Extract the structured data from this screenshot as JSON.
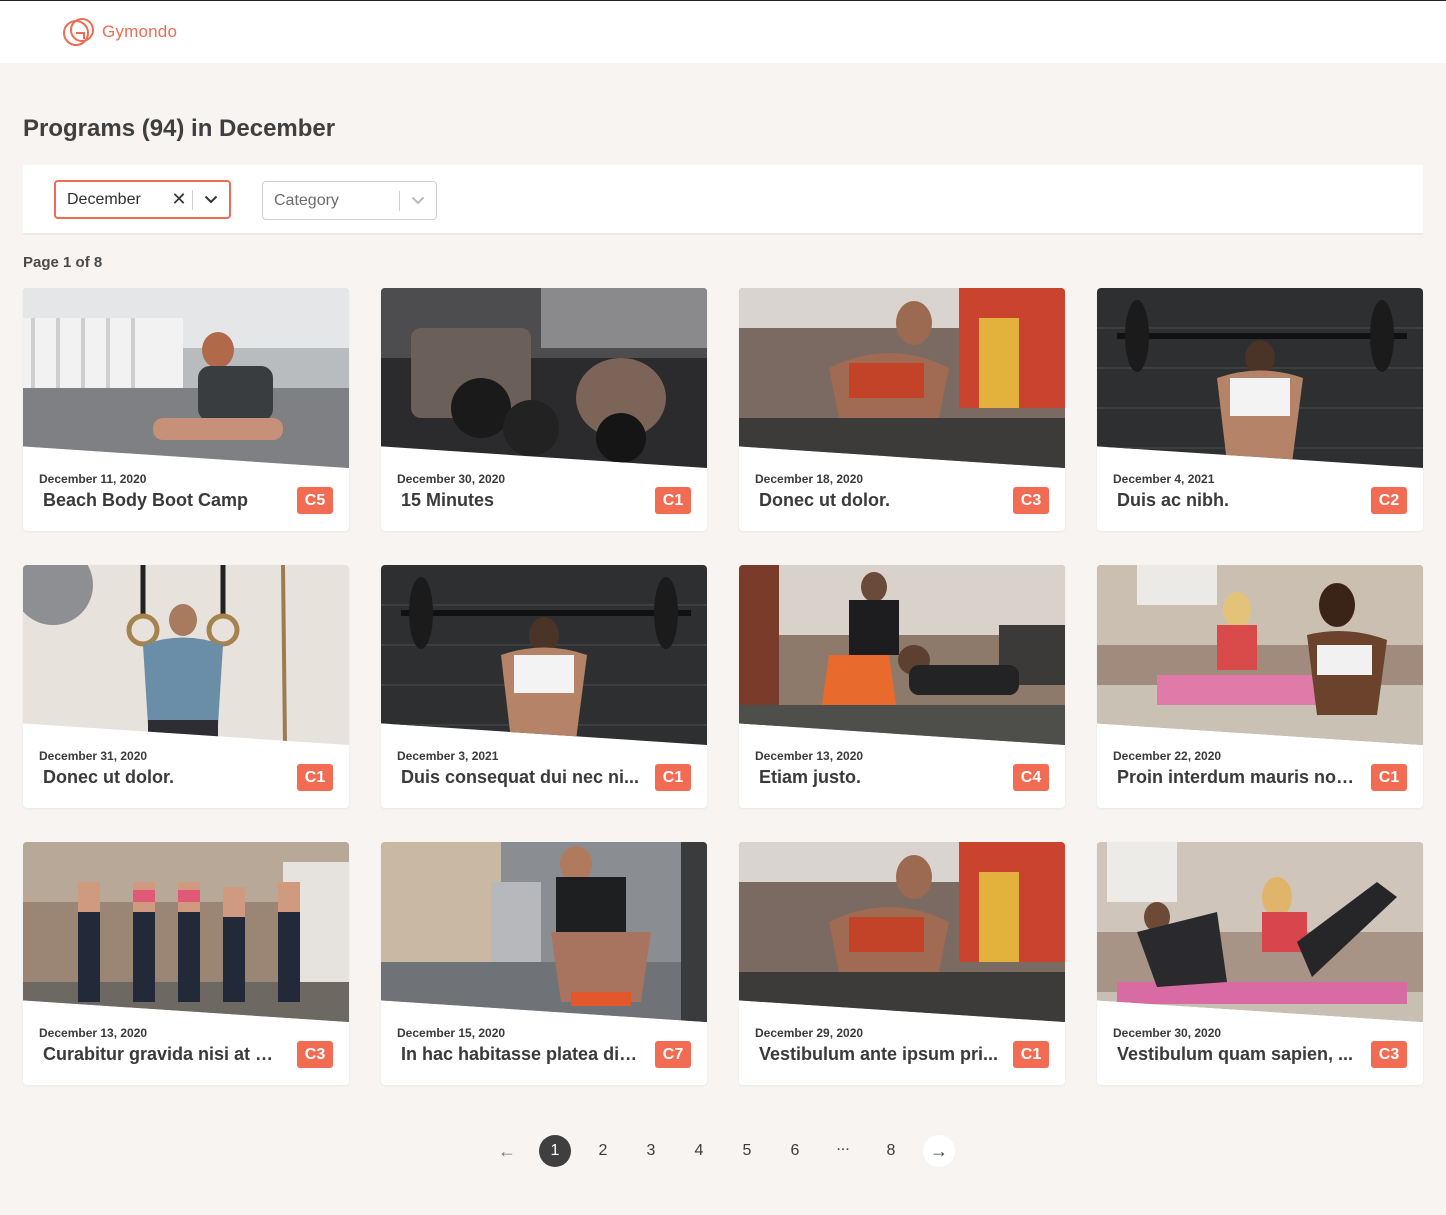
{
  "header": {
    "logo_text": "Gymondo",
    "brand_color": "#ef6b53"
  },
  "page_title": "Programs (94) in December",
  "filters": {
    "month": {
      "value": "December",
      "clear_icon": "close-icon",
      "dropdown_icon": "chevron-down-icon"
    },
    "category": {
      "placeholder": "Category",
      "dropdown_icon": "chevron-down-icon"
    }
  },
  "page_info": "Page 1 of 8",
  "programs": [
    {
      "date": "December 11, 2020",
      "title": "Beach Body Boot Camp",
      "badge": "C5",
      "image": "man-stretching-on-deck"
    },
    {
      "date": "December 30, 2020",
      "title": "15 Minutes",
      "badge": "C1",
      "image": "dumbbell-closeup"
    },
    {
      "date": "December 18, 2020",
      "title": "Donec ut dolor.",
      "badge": "C3",
      "image": "woman-gym-dumbbell-rack"
    },
    {
      "date": "December 4, 2021",
      "title": "Duis ac nibh.",
      "badge": "C2",
      "image": "woman-barbell-back"
    },
    {
      "date": "December 31, 2020",
      "title": "Donec ut dolor.",
      "badge": "C1",
      "image": "woman-gymnastic-rings"
    },
    {
      "date": "December 3, 2021",
      "title": "Duis consequat dui nec ni...",
      "badge": "C1",
      "image": "woman-barbell-back"
    },
    {
      "date": "December 13, 2020",
      "title": "Etiam justo.",
      "badge": "C4",
      "image": "trainer-pushup"
    },
    {
      "date": "December 22, 2020",
      "title": "Proin interdum mauris non...",
      "badge": "C1",
      "image": "group-class-mats"
    },
    {
      "date": "December 13, 2020",
      "title": "Curabitur gravida nisi at ni...",
      "badge": "C3",
      "image": "group-dumbbells-raised"
    },
    {
      "date": "December 15, 2020",
      "title": "In hac habitasse platea dic...",
      "badge": "C7",
      "image": "man-tying-shoe-street"
    },
    {
      "date": "December 29, 2020",
      "title": "Vestibulum ante ipsum pri...",
      "badge": "C1",
      "image": "woman-gym-dumbbell-rack"
    },
    {
      "date": "December 30, 2020",
      "title": "Vestibulum quam sapien, ...",
      "badge": "C3",
      "image": "women-leg-kicks-mats"
    }
  ],
  "pagination": {
    "prev": "←",
    "pages": [
      "1",
      "2",
      "3",
      "4",
      "5",
      "6",
      "...",
      "8"
    ],
    "current": "1",
    "next": "→"
  }
}
